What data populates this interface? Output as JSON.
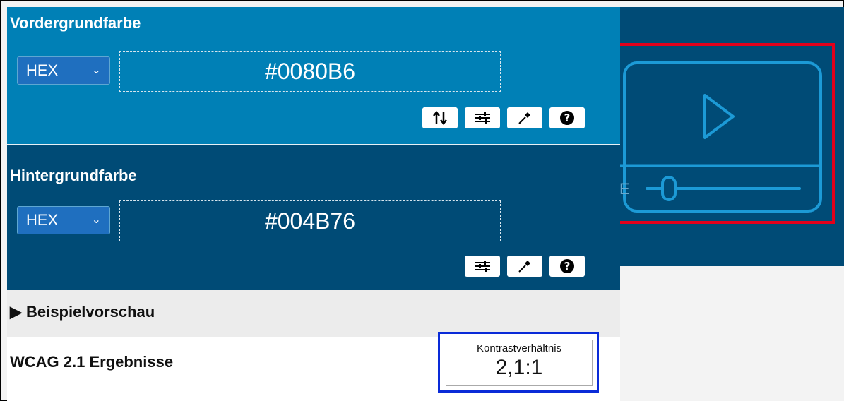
{
  "foreground": {
    "title": "Vordergrundfarbe",
    "format": "HEX",
    "value": "#0080B6",
    "color": "#0080b6"
  },
  "background": {
    "title": "Hintergrundfarbe",
    "format": "HEX",
    "value": "#004B76",
    "color": "#004b76"
  },
  "preview": {
    "label": "Beispielvorschau"
  },
  "results": {
    "title": "WCAG 2.1 Ergebnisse",
    "ratio_label": "Kontrastverhältnis",
    "ratio_value": "2,1:1"
  },
  "player_stub_text": "E",
  "icons": [
    "swap-icon",
    "sliders-icon",
    "eyedropper-icon",
    "help-icon",
    "play-icon",
    "slider-icon"
  ],
  "highlight_colors": {
    "red": "#e3001b",
    "blue": "#0a2bd8"
  }
}
